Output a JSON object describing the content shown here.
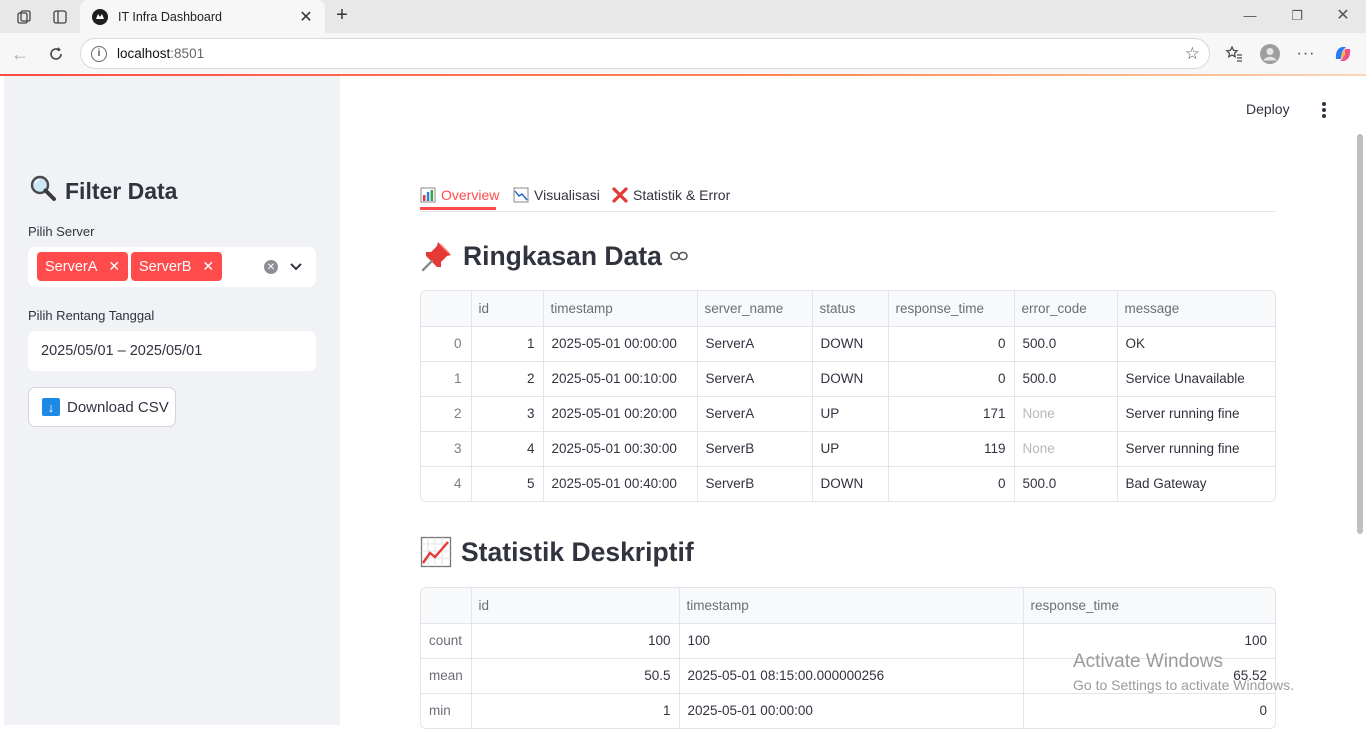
{
  "browser": {
    "tab_title": "IT Infra Dashboard",
    "url_host": "localhost",
    "url_port": ":8501"
  },
  "sidebar": {
    "title": "Filter Data",
    "server_label": "Pilih Server",
    "selected_servers": [
      "ServerA",
      "ServerB"
    ],
    "date_label": "Pilih Rentang Tanggal",
    "date_value": "2025/05/01 – 2025/05/01",
    "download_label": "Download CSV"
  },
  "header": {
    "deploy_label": "Deploy"
  },
  "tabs": [
    {
      "label": "Overview",
      "icon": "bar-chart-icon",
      "active": true
    },
    {
      "label": "Visualisasi",
      "icon": "line-chart-icon",
      "active": false
    },
    {
      "label": "Statistik & Error",
      "icon": "cross-mark-icon",
      "active": false
    }
  ],
  "summary": {
    "heading": "Ringkasan Data",
    "columns": [
      "",
      "id",
      "timestamp",
      "server_name",
      "status",
      "response_time",
      "error_code",
      "message"
    ],
    "rows": [
      [
        "0",
        "1",
        "2025-05-01 00:00:00",
        "ServerA",
        "DOWN",
        "0",
        "500.0",
        "OK"
      ],
      [
        "1",
        "2",
        "2025-05-01 00:10:00",
        "ServerA",
        "DOWN",
        "0",
        "500.0",
        "Service Unavailable"
      ],
      [
        "2",
        "3",
        "2025-05-01 00:20:00",
        "ServerA",
        "UP",
        "171",
        "None",
        "Server running fine"
      ],
      [
        "3",
        "4",
        "2025-05-01 00:30:00",
        "ServerB",
        "UP",
        "119",
        "None",
        "Server running fine"
      ],
      [
        "4",
        "5",
        "2025-05-01 00:40:00",
        "ServerB",
        "DOWN",
        "0",
        "500.0",
        "Bad Gateway"
      ]
    ]
  },
  "stats": {
    "heading": "Statistik Deskriptif",
    "columns": [
      "",
      "id",
      "timestamp",
      "response_time"
    ],
    "rows": [
      [
        "count",
        "100",
        "100",
        "100"
      ],
      [
        "mean",
        "50.5",
        "2025-05-01 08:15:00.000000256",
        "65.52"
      ],
      [
        "min",
        "1",
        "2025-05-01 00:00:00",
        "0"
      ]
    ]
  },
  "watermark": {
    "line1": "Activate Windows",
    "line2": "Go to Settings to activate Windows."
  },
  "colors": {
    "accent": "#ff4b4b",
    "sidebar_bg": "#f0f2f6"
  }
}
